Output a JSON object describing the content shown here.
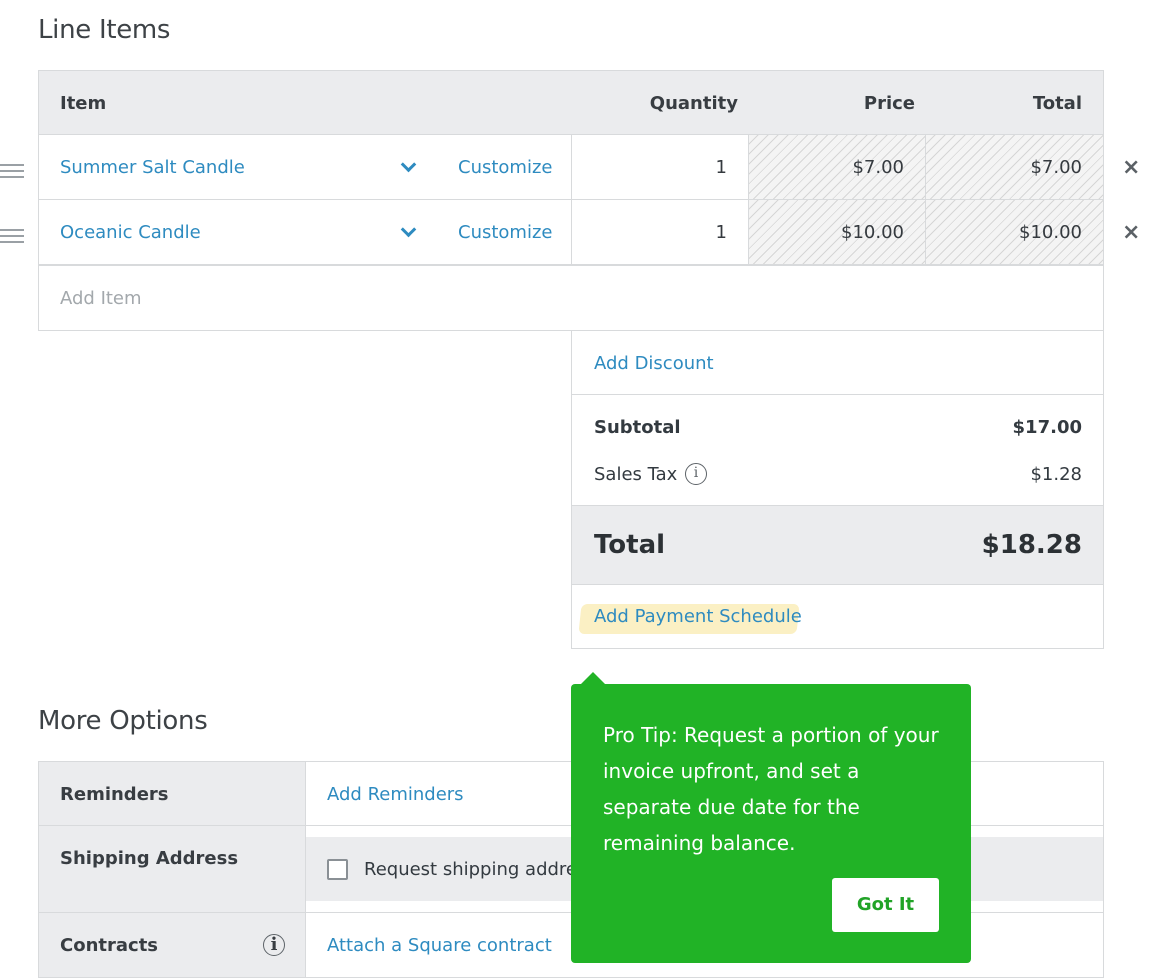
{
  "line_items": {
    "title": "Line Items",
    "columns": {
      "item": "Item",
      "quantity": "Quantity",
      "price": "Price",
      "total": "Total"
    },
    "rows": [
      {
        "name": "Summer Salt Candle",
        "customize": "Customize",
        "quantity": "1",
        "price": "$7.00",
        "total": "$7.00"
      },
      {
        "name": "Oceanic Candle",
        "customize": "Customize",
        "quantity": "1",
        "price": "$10.00",
        "total": "$10.00"
      }
    ],
    "add_item_placeholder": "Add Item",
    "add_discount": "Add Discount",
    "subtotal_label": "Subtotal",
    "subtotal_value": "$17.00",
    "sales_tax_label": "Sales Tax",
    "sales_tax_value": "$1.28",
    "total_label": "Total",
    "total_value": "$18.28",
    "add_payment_schedule": "Add Payment Schedule"
  },
  "more_options": {
    "title": "More Options",
    "reminders_label": "Reminders",
    "reminders_action": "Add Reminders",
    "shipping_label": "Shipping Address",
    "shipping_checkbox_label": "Request shipping address",
    "contracts_label": "Contracts",
    "contracts_action": "Attach a Square contract"
  },
  "tooltip": {
    "text": "Pro Tip: Request a portion of your invoice upfront, and set a separate due date for the remaining balance.",
    "button": "Got It"
  },
  "colors": {
    "link": "#2e8bc0",
    "tooltip_bg": "#21b326",
    "header_bg": "#ebecee"
  }
}
